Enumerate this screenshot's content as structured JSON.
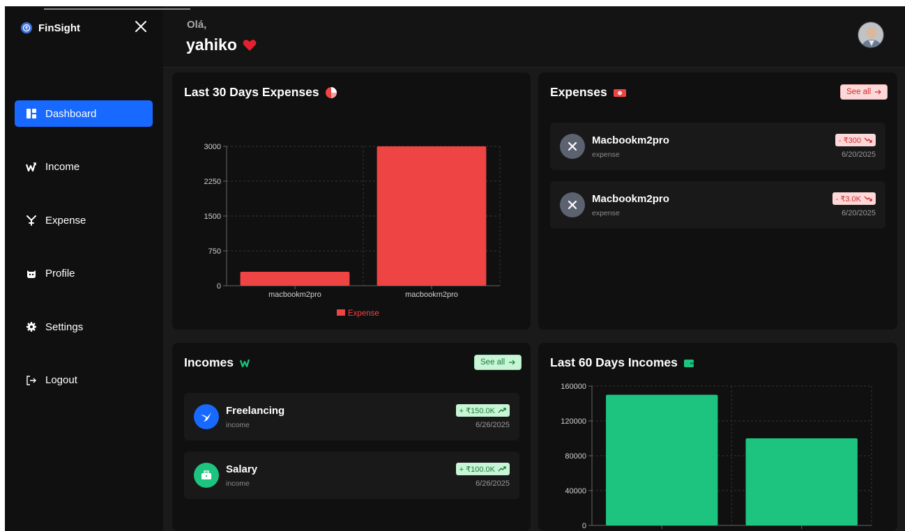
{
  "brand": {
    "name": "FinSight"
  },
  "nav": [
    {
      "label": "Dashboard",
      "icon": "dashboard-icon",
      "active": true
    },
    {
      "label": "Income",
      "icon": "income-icon"
    },
    {
      "label": "Expense",
      "icon": "expense-icon"
    },
    {
      "label": "Profile",
      "icon": "profile-icon"
    },
    {
      "label": "Settings",
      "icon": "gear-icon"
    },
    {
      "label": "Logout",
      "icon": "logout-icon"
    }
  ],
  "header": {
    "greeting": "Olá,",
    "name": "yahiko"
  },
  "expenses_chart_card": {
    "title": "Last 30 Days Expenses"
  },
  "expenses_card": {
    "title": "Expenses",
    "see_all": "See all",
    "items": [
      {
        "name": "Macbookm2pro",
        "category": "expense",
        "amount": "- ₹300",
        "date": "6/20/2025"
      },
      {
        "name": "Macbookm2pro",
        "category": "expense",
        "amount": "- ₹3.0K",
        "date": "6/20/2025"
      }
    ]
  },
  "incomes_card": {
    "title": "Incomes",
    "see_all": "See all",
    "items": [
      {
        "name": "Freelancing",
        "category": "income",
        "amount": "+ ₹150.0K",
        "date": "6/26/2025"
      },
      {
        "name": "Salary",
        "category": "income",
        "amount": "+ ₹100.0K",
        "date": "6/26/2025"
      }
    ]
  },
  "income_chart_card": {
    "title": "Last 60 Days Incomes"
  },
  "colors": {
    "accent": "#1769ff",
    "expense": "#ef4444",
    "income": "#1dc47f",
    "background": "#1a1a1a"
  },
  "chart_data": [
    {
      "type": "bar",
      "title": "Last 30 Days Expenses",
      "categories": [
        "macbookm2pro",
        "macbookm2pro"
      ],
      "series": [
        {
          "name": "Expense",
          "values": [
            300,
            3000
          ]
        }
      ],
      "ylim": [
        0,
        3000
      ],
      "yticks": [
        0,
        750,
        1500,
        2250,
        3000
      ],
      "grid": true,
      "legend": "bottom"
    },
    {
      "type": "bar",
      "title": "Last 60 Days Incomes",
      "categories": [
        "",
        ""
      ],
      "series": [
        {
          "values": [
            150000,
            100000
          ]
        }
      ],
      "ylim": [
        0,
        160000
      ],
      "yticks": [
        0,
        40000,
        80000,
        120000,
        160000
      ],
      "grid": true
    }
  ]
}
